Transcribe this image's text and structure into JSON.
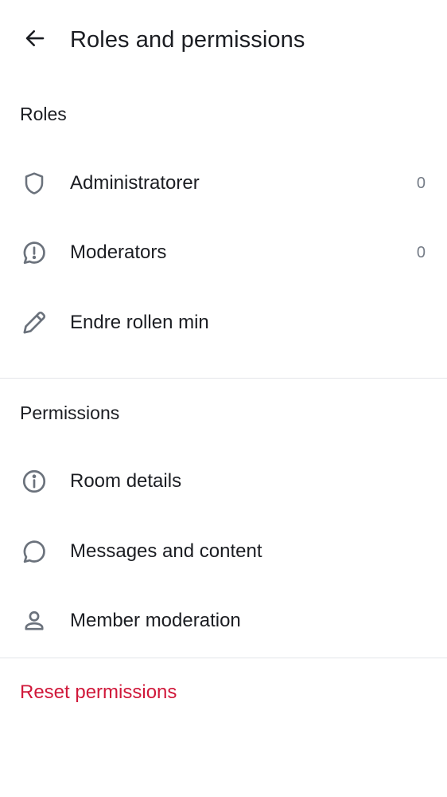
{
  "header": {
    "title": "Roles and permissions",
    "back_icon": "arrow-left-icon"
  },
  "roles": {
    "heading": "Roles",
    "items": [
      {
        "label": "Administratorer",
        "count": "0",
        "icon": "shield-icon"
      },
      {
        "label": "Moderators",
        "count": "0",
        "icon": "chat-alert-icon"
      },
      {
        "label": "Endre rollen min",
        "icon": "pencil-icon"
      }
    ]
  },
  "permissions": {
    "heading": "Permissions",
    "items": [
      {
        "label": "Room details",
        "icon": "info-icon"
      },
      {
        "label": "Messages and content",
        "icon": "chat-bubble-icon"
      },
      {
        "label": "Member moderation",
        "icon": "user-icon"
      }
    ]
  },
  "reset": {
    "label": "Reset permissions"
  },
  "colors": {
    "text": "#1b1d22",
    "icon": "#6b727c",
    "count": "#757c87",
    "divider": "#e3e5e9",
    "critical": "#d0183a"
  }
}
